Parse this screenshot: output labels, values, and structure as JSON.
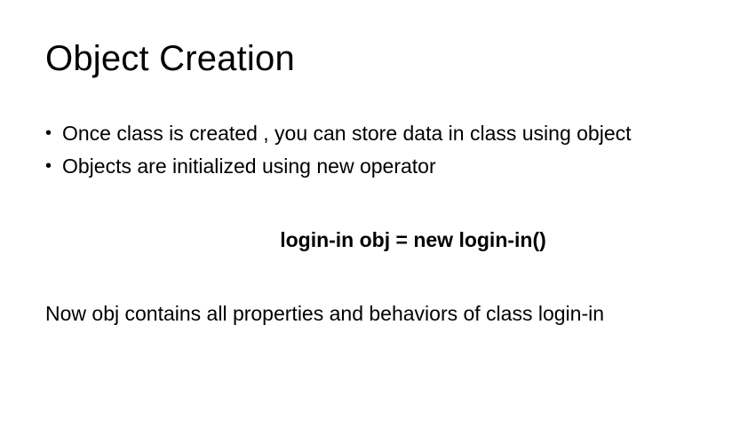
{
  "slide": {
    "title": "Object Creation",
    "bullets": [
      {
        "marker": "•",
        "text": "Once class is created , you can store data in class using object"
      },
      {
        "marker": "•",
        "text": "Objects are initialized using new operator"
      }
    ],
    "code": "login-in obj = new login-in()",
    "summary": "Now obj contains all properties and behaviors of class login-in"
  }
}
